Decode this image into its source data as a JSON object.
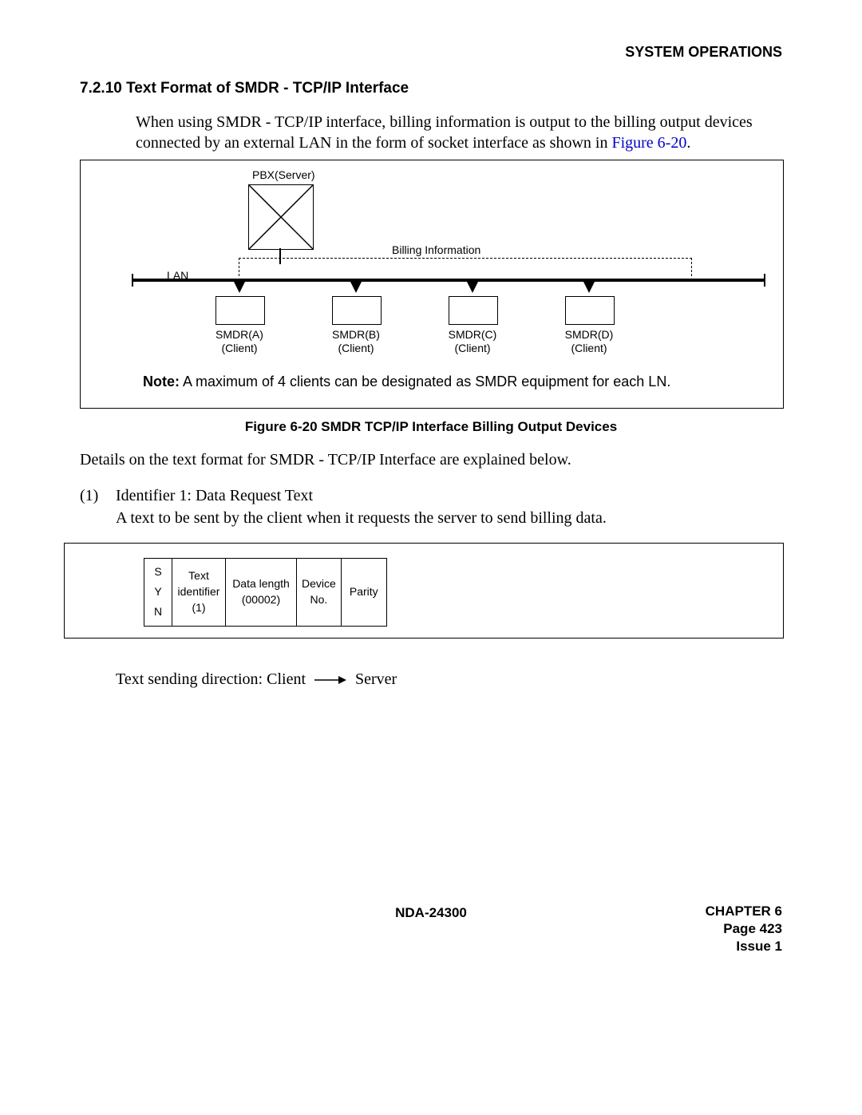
{
  "header": {
    "right": "SYSTEM OPERATIONS"
  },
  "section": {
    "number": "7.2.10",
    "title": "Text Format of SMDR - TCP/IP Interface"
  },
  "intro": {
    "text_before_link": "When using SMDR - TCP/IP interface, billing information is output to the billing output devices connected by an external LAN in the form of socket interface as shown in ",
    "link": "Figure 6-20",
    "text_after_link": "."
  },
  "figure": {
    "pbx_label": "PBX(Server)",
    "billing_label": "Billing Information",
    "lan_label": "LAN",
    "clients": [
      {
        "name": "SMDR(A)",
        "role": "(Client)"
      },
      {
        "name": "SMDR(B)",
        "role": "(Client)"
      },
      {
        "name": "SMDR(C)",
        "role": "(Client)"
      },
      {
        "name": "SMDR(D)",
        "role": "(Client)"
      }
    ],
    "note_bold": "Note:",
    "note_text": " A maximum of 4 clients can be designated as SMDR equipment for each LN.",
    "caption": "Figure 6-20   SMDR    TCP/IP Interface Billing Output Devices"
  },
  "details": "Details on the text format for SMDR - TCP/IP Interface are explained below.",
  "item": {
    "num": "(1)",
    "title": "Identifier 1: Data Request Text",
    "desc": "A text to be sent by the client when it requests the server to send billing data."
  },
  "table": {
    "cells": [
      {
        "l1": "S",
        "l2": "Y",
        "l3": "N"
      },
      {
        "l1": "Text",
        "l2": "identifier",
        "l3": "(1)"
      },
      {
        "l1": "Data length",
        "l2": "(00002)"
      },
      {
        "l1": "Device",
        "l2": "No."
      },
      {
        "l1": "Parity"
      }
    ]
  },
  "sending": {
    "before": "Text sending direction: Client",
    "after": "Server"
  },
  "footer": {
    "center": "NDA-24300",
    "chapter": "CHAPTER 6",
    "page": "Page 423",
    "issue": "Issue 1"
  }
}
